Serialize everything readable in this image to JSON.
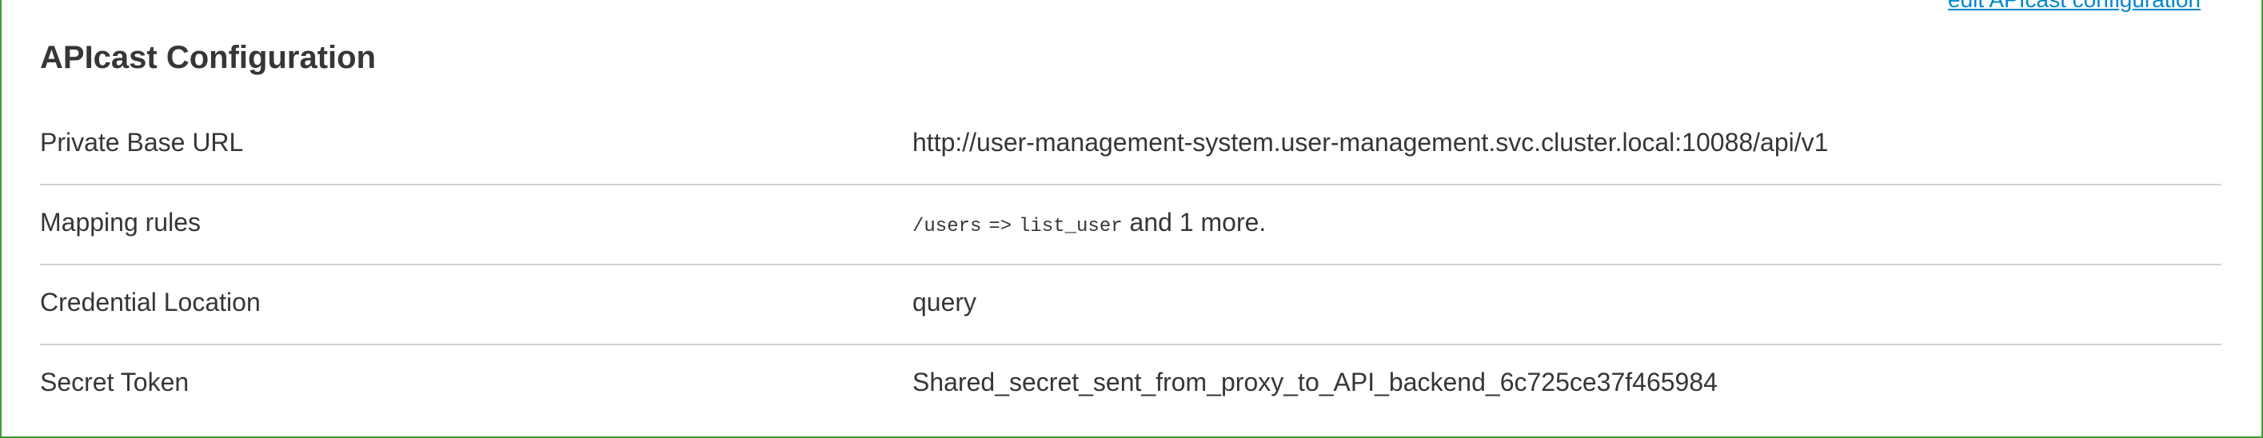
{
  "header": {
    "edit_link": "edit APIcast configuration",
    "title": "APIcast Configuration"
  },
  "rows": [
    {
      "label": "Private Base URL",
      "value": "http://user-management-system.user-management.svc.cluster.local:10088/api/v1"
    },
    {
      "label": "Mapping rules",
      "rule_path": "/users",
      "rule_arrow": "=>",
      "rule_target": "list_user",
      "suffix": "and 1 more."
    },
    {
      "label": "Credential Location",
      "value": "query"
    },
    {
      "label": "Secret Token",
      "value": "Shared_secret_sent_from_proxy_to_API_backend_6c725ce37f465984"
    }
  ],
  "colors": {
    "panel_border": "#3f9c35",
    "link": "#0088ce",
    "text": "#363636",
    "divider": "#d1d1d1"
  }
}
